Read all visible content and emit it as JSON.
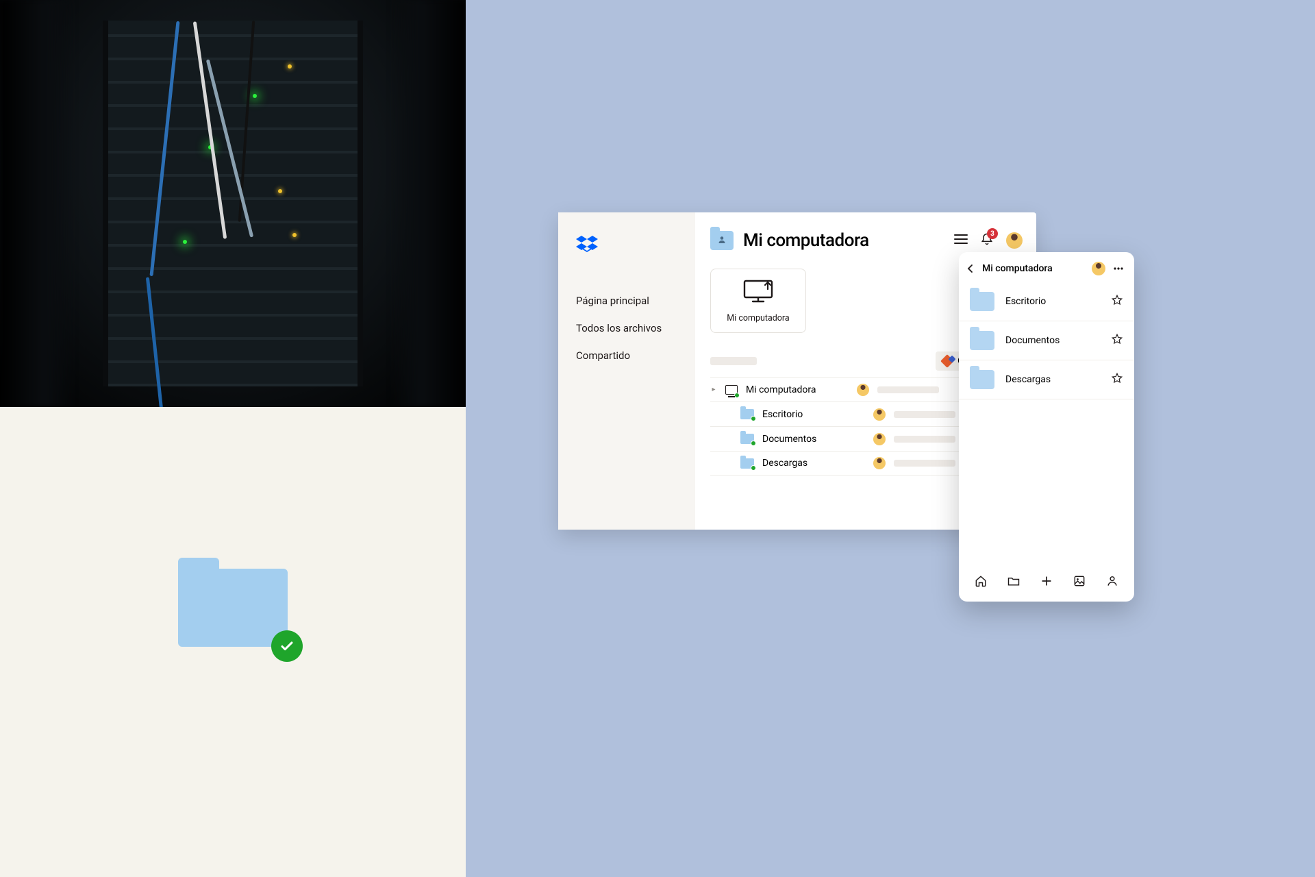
{
  "desktop": {
    "sidebar": {
      "items": [
        {
          "label": "Página principal"
        },
        {
          "label": "Todos los archivos"
        },
        {
          "label": "Compartido"
        }
      ]
    },
    "header": {
      "title": "Mi computadora",
      "notification_count": "3"
    },
    "card_label": "Mi computadora",
    "create_label": "Crear",
    "rows": [
      {
        "name": "Mi computadora"
      },
      {
        "name": "Escritorio"
      },
      {
        "name": "Documentos"
      },
      {
        "name": "Descargas"
      }
    ]
  },
  "mobile": {
    "title": "Mi computadora",
    "rows": [
      {
        "name": "Escritorio"
      },
      {
        "name": "Documentos"
      },
      {
        "name": "Descargas"
      }
    ]
  }
}
